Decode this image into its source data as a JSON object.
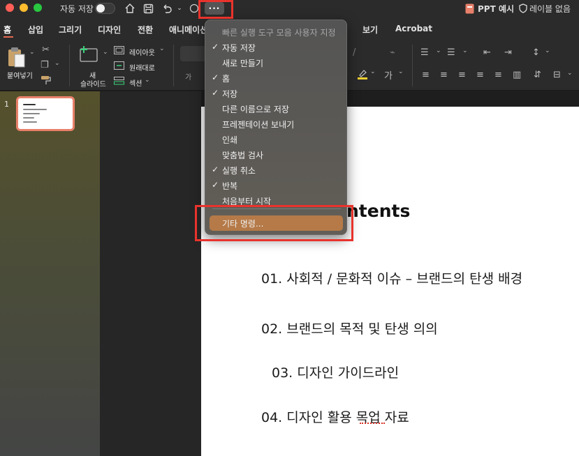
{
  "titlebar": {
    "autosave_label": "자동 저장",
    "more_label": "···",
    "doc_title": "PPT 예시",
    "label_status": "레이블 없음"
  },
  "tabs": [
    {
      "label": "홈"
    },
    {
      "label": "삽입"
    },
    {
      "label": "그리기"
    },
    {
      "label": "디자인"
    },
    {
      "label": "전환"
    },
    {
      "label": "애니메이션"
    },
    {
      "label": "보기"
    },
    {
      "label": "Acrobat"
    }
  ],
  "toolbar": {
    "paste_label": "붙여넣기",
    "new_slide_label_1": "새",
    "new_slide_label_2": "슬라이드",
    "layout_label": "레이아웃",
    "reset_label": "원래대로",
    "section_label": "섹션",
    "font_small_a": "가"
  },
  "slides_panel": {
    "slide_number": "1"
  },
  "slide": {
    "title": "ntents",
    "items": [
      "01. 사회적 / 문화적 이슈 – 브랜드의 탄생 배경",
      "02. 브랜드의 목적 및 탄생 의의",
      "03. 디자인 가이드라인",
      "04. 디자인 활용 목업 자료"
    ]
  },
  "menu": {
    "header": "빠른 실행 도구 모음 사용자 지정",
    "items": [
      {
        "label": "자동 저장",
        "check": "✓"
      },
      {
        "label": "새로 만들기",
        "check": ""
      },
      {
        "label": "홈",
        "check": "✓"
      },
      {
        "label": "저장",
        "check": "✓"
      },
      {
        "label": "다른 이름으로 저장",
        "check": ""
      },
      {
        "label": "프레젠테이션 보내기",
        "check": ""
      },
      {
        "label": "인쇄",
        "check": ""
      },
      {
        "label": "맞춤법 검사",
        "check": ""
      },
      {
        "label": "실행 취소",
        "check": "✓"
      },
      {
        "label": "반복",
        "check": "✓"
      },
      {
        "label": "처음부터 시작",
        "check": ""
      }
    ],
    "more_commands": "기타 명령..."
  },
  "colors": {
    "highlight_box": "#e8332c",
    "menu_highlight": "#b57a48",
    "thumb_border": "#e8806a"
  }
}
